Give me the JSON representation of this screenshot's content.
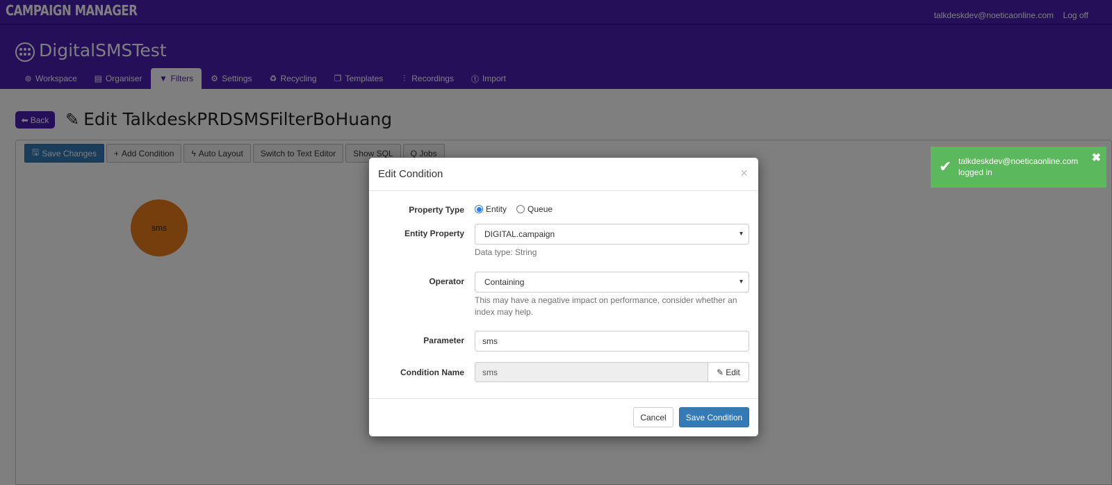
{
  "topbar": {
    "brand": "CAMPAIGN MANAGER",
    "user_email": "talkdeskdev@noeticaonline.com",
    "logoff_label": "Log off"
  },
  "header": {
    "app_title": "DigitalSMSTest",
    "tabs": [
      {
        "label": "Workspace",
        "icon": "grid-circle-icon",
        "active": false
      },
      {
        "label": "Organiser",
        "icon": "book-icon",
        "active": false
      },
      {
        "label": "Filters",
        "icon": "filter-icon",
        "active": true
      },
      {
        "label": "Settings",
        "icon": "gear-icon",
        "active": false
      },
      {
        "label": "Recycling",
        "icon": "recycle-icon",
        "active": false
      },
      {
        "label": "Templates",
        "icon": "copy-icon",
        "active": false
      },
      {
        "label": "Recordings",
        "icon": "audio-wave-icon",
        "active": false
      },
      {
        "label": "Import",
        "icon": "import-icon",
        "active": false
      }
    ]
  },
  "page": {
    "back_label": "Back",
    "title": "Edit TalkdeskPRDSMSFilterBoHuang"
  },
  "toolbar": {
    "save_changes": "Save Changes",
    "add_condition": "Add Condition",
    "auto_layout": "Auto Layout",
    "switch_text_editor": "Switch to Text Editor",
    "show_sql": "Show SQL",
    "q_jobs": "Q Jobs"
  },
  "canvas": {
    "node_label": "sms",
    "node_color": "#e87f18"
  },
  "toast": {
    "line1": "talkdeskdev@noeticaonline.com",
    "line2": "logged in",
    "color": "#5cb85c"
  },
  "modal": {
    "title": "Edit Condition",
    "property_type_label": "Property Type",
    "property_type_options": [
      "Entity",
      "Queue"
    ],
    "property_type_selected": "Entity",
    "entity_property_label": "Entity Property",
    "entity_property_value": "DIGITAL.campaign",
    "data_type_help": "Data type: String",
    "operator_label": "Operator",
    "operator_value": "Containing",
    "operator_help": "This may have a negative impact on performance, consider whether an index may help.",
    "parameter_label": "Parameter",
    "parameter_value": "sms",
    "condition_name_label": "Condition Name",
    "condition_name_value": "sms",
    "edit_label": "Edit",
    "cancel_label": "Cancel",
    "save_label": "Save Condition"
  },
  "colors": {
    "brand_purple": "#4b1fb0",
    "primary_blue": "#337ab7"
  }
}
